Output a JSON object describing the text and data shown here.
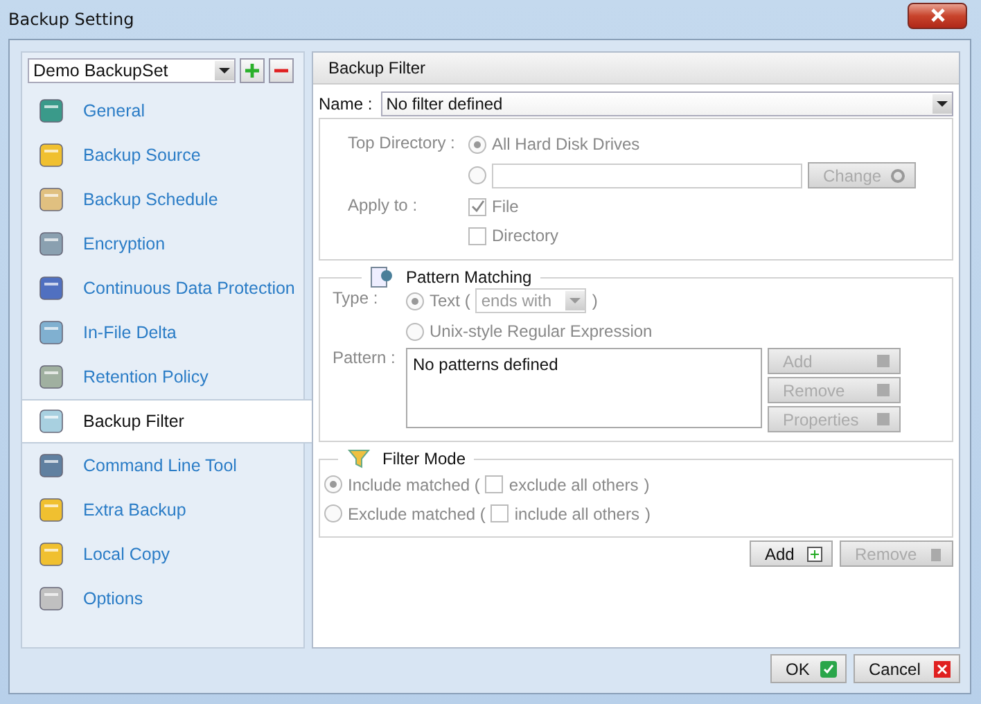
{
  "window": {
    "title": "Backup Setting"
  },
  "sidebar": {
    "backupset": "Demo BackupSet",
    "items": [
      {
        "label": "General",
        "selected": false
      },
      {
        "label": "Backup Source",
        "selected": false
      },
      {
        "label": "Backup Schedule",
        "selected": false
      },
      {
        "label": "Encryption",
        "selected": false
      },
      {
        "label": "Continuous Data Protection",
        "selected": false
      },
      {
        "label": "In-File Delta",
        "selected": false
      },
      {
        "label": "Retention Policy",
        "selected": false
      },
      {
        "label": "Backup Filter",
        "selected": true
      },
      {
        "label": "Command Line Tool",
        "selected": false
      },
      {
        "label": "Extra Backup",
        "selected": false
      },
      {
        "label": "Local Copy",
        "selected": false
      },
      {
        "label": "Options",
        "selected": false
      }
    ]
  },
  "panel": {
    "title": "Backup Filter",
    "name_label": "Name :",
    "name_value": "No filter defined",
    "top_directory": {
      "label": "Top Directory :",
      "options": [
        {
          "label": "All Hard Disk Drives",
          "selected": true
        },
        {
          "selected": false
        }
      ],
      "change": {
        "label": "Change",
        "disabled": true
      }
    },
    "apply_to": {
      "label": "Apply to :",
      "options": [
        {
          "label": "File",
          "checked": true
        },
        {
          "label": "Directory",
          "checked": false
        }
      ]
    },
    "pattern_matching": {
      "title": "Pattern Matching",
      "type_label": "Type :",
      "text_option": {
        "label": "Text (",
        "selected": true
      },
      "text_mode": "ends with",
      "close_paren": ")",
      "regex_option": {
        "label": "Unix-style Regular Expression",
        "selected": false
      },
      "pattern_label": "Pattern :",
      "pattern_text": "No patterns defined",
      "buttons": [
        {
          "label": "Add",
          "disabled": true
        },
        {
          "label": "Remove",
          "disabled": true
        },
        {
          "label": "Properties",
          "disabled": true
        }
      ]
    },
    "filter_mode": {
      "title": "Filter Mode",
      "options": [
        {
          "label": "Include matched (",
          "selected": true,
          "sub_label": "exclude all others",
          "sub_checked": false,
          "close": ")"
        },
        {
          "label": "Exclude matched (",
          "selected": false,
          "sub_label": "include all others",
          "sub_checked": false,
          "close": ")"
        }
      ]
    },
    "buttons": [
      {
        "label": "Add",
        "disabled": false
      },
      {
        "label": "Remove",
        "disabled": true
      }
    ]
  },
  "footer": {
    "buttons": [
      {
        "label": "OK"
      },
      {
        "label": "Cancel"
      }
    ]
  }
}
